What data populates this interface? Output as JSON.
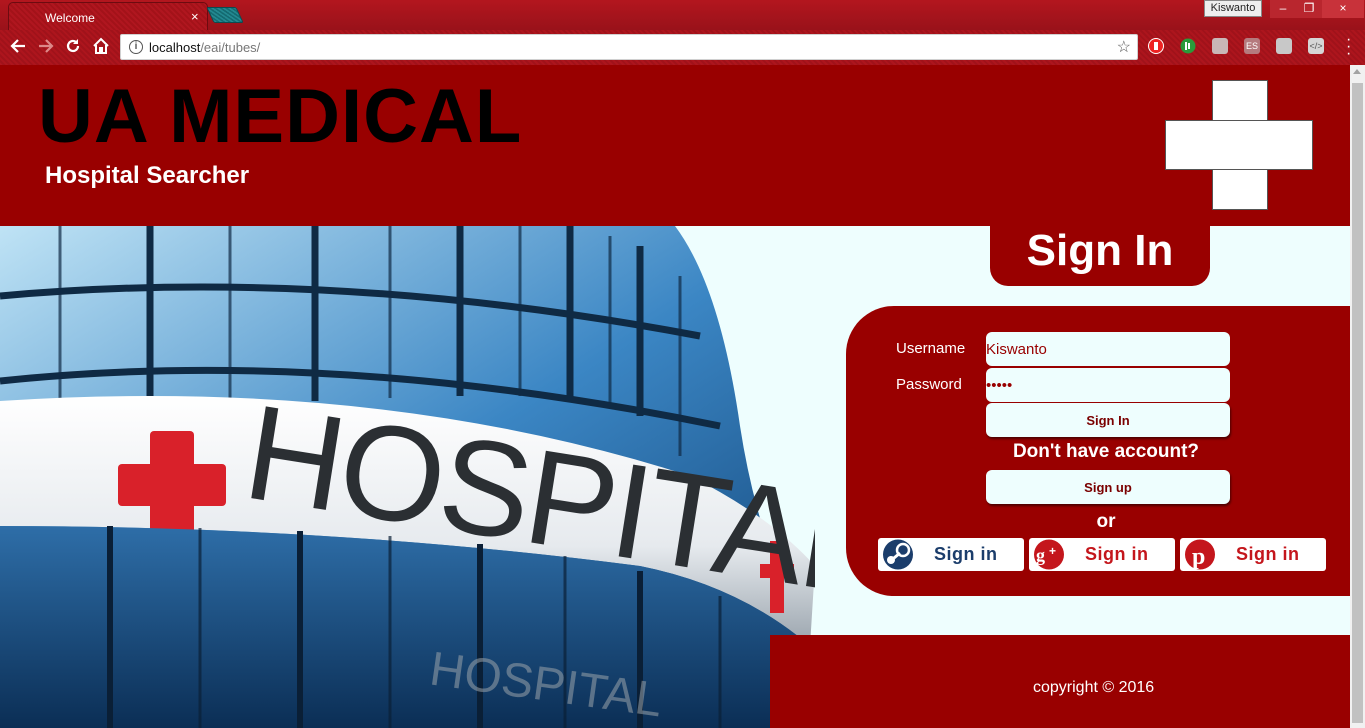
{
  "browser": {
    "tab_title": "Welcome",
    "tab_close": "×",
    "profile_name": "Kiswanto",
    "url_host": "localhost",
    "url_path": "/eai/tubes/",
    "win_min": "–",
    "win_max": "❐",
    "win_close": "×"
  },
  "header": {
    "brand": "UA MEDICAL",
    "subtitle": "Hospital Searcher"
  },
  "hero": {
    "sign_text": "HOSPITAL",
    "reflection_text": "HOSPITAL"
  },
  "signin": {
    "title": "Sign In",
    "username_label": "Username",
    "username_value": "Kiswanto",
    "password_label": "Password",
    "password_value": "•••••",
    "signin_button": "Sign In",
    "no_account": "Don't have account?",
    "signup_button": "Sign up",
    "or": "or",
    "social": [
      {
        "provider": "steam",
        "label": "Sign in",
        "color": "#1b3d6b"
      },
      {
        "provider": "google-plus",
        "label": "Sign in",
        "color": "#c4161c"
      },
      {
        "provider": "pinterest",
        "label": "Sign in",
        "color": "#c4161c"
      }
    ]
  },
  "footer": {
    "copyright": "copyright © 2016"
  },
  "colors": {
    "brand_red": "#990000",
    "panel_bg": "#eefefe",
    "chrome_red": "#a4141c"
  }
}
